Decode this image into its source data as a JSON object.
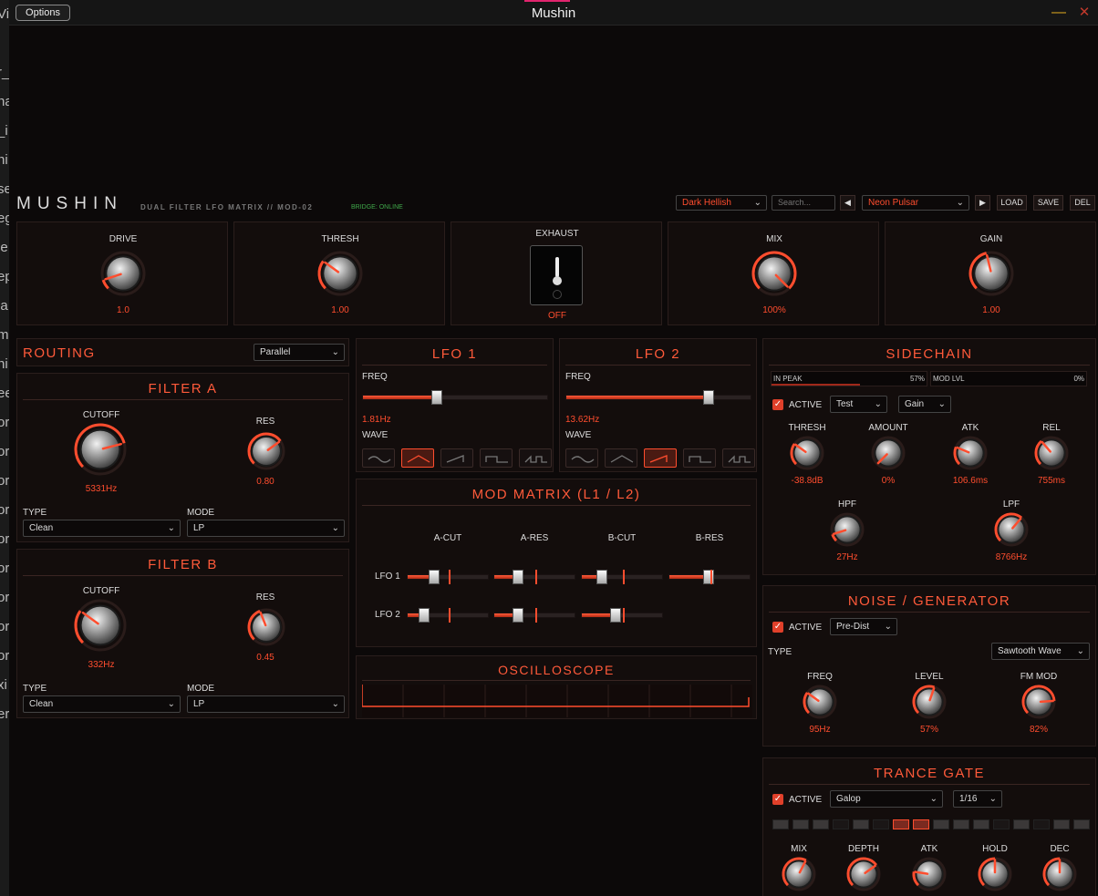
{
  "window": {
    "title": "Mushin",
    "options_label": "Options",
    "minimize_glyph": "—",
    "close_glyph": "✕"
  },
  "background_text": [
    "Vi",
    "",
    "r_",
    "na",
    "_i",
    "ni",
    "se",
    "eg",
    "le",
    "ep",
    "la",
    "m",
    "ni",
    "ee",
    "or",
    "or",
    "or",
    "or",
    "or",
    "or",
    "or",
    "or",
    "or",
    "xi",
    "er"
  ],
  "plugin": {
    "logo": "MUSHIN",
    "subtitle": "DUAL FILTER LFO MATRIX // MOD-02",
    "bridge_status": "BRIDGE: ONLINE",
    "theme_select": "Dark Hellish",
    "search_placeholder": "Search...",
    "preset": "Neon Pulsar",
    "prev_glyph": "◀",
    "next_glyph": "▶",
    "load": "LOAD",
    "save": "SAVE",
    "del": "DEL"
  },
  "top": {
    "drive": {
      "label": "DRIVE",
      "value": "1.0",
      "level": 0.1
    },
    "thresh": {
      "label": "THRESH",
      "value": "1.00",
      "level": 0.3
    },
    "exhaust": {
      "label": "EXHAUST",
      "value": "OFF"
    },
    "mix": {
      "label": "MIX",
      "value": "100%",
      "level": 1.0
    },
    "gain": {
      "label": "GAIN",
      "value": "1.00",
      "level": 0.45
    }
  },
  "routing": {
    "title": "ROUTING",
    "mode": "Parallel"
  },
  "filter_a": {
    "title": "FILTER A",
    "cutoff_label": "CUTOFF",
    "cutoff_value": "5331Hz",
    "cutoff_level": 0.78,
    "res_label": "RES",
    "res_value": "0.80",
    "res_level": 0.7,
    "type_label": "TYPE",
    "type": "Clean",
    "mode_label": "MODE",
    "mode": "LP"
  },
  "filter_b": {
    "title": "FILTER B",
    "cutoff_label": "CUTOFF",
    "cutoff_value": "332Hz",
    "cutoff_level": 0.3,
    "res_label": "RES",
    "res_value": "0.45",
    "res_level": 0.42,
    "type_label": "TYPE",
    "type": "Clean",
    "mode_label": "MODE",
    "mode": "LP"
  },
  "lfo1": {
    "title": "LFO 1",
    "freq_label": "FREQ",
    "freq_value": "1.81Hz",
    "freq_level": 0.39,
    "wave_label": "WAVE",
    "active_wave": 1
  },
  "lfo2": {
    "title": "LFO 2",
    "freq_label": "FREQ",
    "freq_value": "13.62Hz",
    "freq_level": 0.78,
    "wave_label": "WAVE",
    "active_wave": 2
  },
  "matrix": {
    "title": "MOD MATRIX (L1 / L2)",
    "columns": [
      "A-CUT",
      "A-RES",
      "B-CUT",
      "B-RES"
    ],
    "rows": [
      "LFO 1",
      "LFO 2"
    ],
    "amounts": [
      [
        0.3,
        0.25,
        0.2,
        0.47
      ],
      [
        0.15,
        0.25,
        0.4,
        null
      ]
    ]
  },
  "scope": {
    "title": "OSCILLOSCOPE"
  },
  "sidechain": {
    "title": "SIDECHAIN",
    "in_peak_label": "IN PEAK",
    "in_peak_value": "57%",
    "in_peak_level": 0.57,
    "mod_lvl_label": "MOD LVL",
    "mod_lvl_value": "0%",
    "mod_lvl_level": 0,
    "active_label": "ACTIVE",
    "source": "Test",
    "target": "Gain",
    "knobs": [
      {
        "label": "THRESH",
        "value": "-38.8dB",
        "level": 0.3
      },
      {
        "label": "AMOUNT",
        "value": "0%",
        "level": 0.0
      },
      {
        "label": "ATK",
        "value": "106.6ms",
        "level": 0.25
      },
      {
        "label": "REL",
        "value": "755ms",
        "level": 0.35
      },
      {
        "label": "HPF",
        "value": "27Hz",
        "level": 0.1
      },
      {
        "label": "LPF",
        "value": "8766Hz",
        "level": 0.65
      }
    ]
  },
  "noise": {
    "title": "NOISE / GENERATOR",
    "active_label": "ACTIVE",
    "position": "Pre-Dist",
    "type_label": "TYPE",
    "type": "Sawtooth Wave",
    "knobs": [
      {
        "label": "FREQ",
        "value": "95Hz",
        "level": 0.3
      },
      {
        "label": "LEVEL",
        "value": "57%",
        "level": 0.57
      },
      {
        "label": "FM MOD",
        "value": "82%",
        "level": 0.82
      }
    ]
  },
  "gate": {
    "title": "TRANCE GATE",
    "active_label": "ACTIVE",
    "pattern": "Galop",
    "rate": "1/16",
    "steps": [
      "on",
      "on",
      "on",
      "dark",
      "on",
      "dark",
      "active",
      "active",
      "on",
      "on",
      "on",
      "dark",
      "on",
      "dark",
      "on",
      "on"
    ],
    "knobs": [
      {
        "label": "MIX",
        "value": "",
        "level": 0.6
      },
      {
        "label": "DEPTH",
        "value": "",
        "level": 0.7
      },
      {
        "label": "ATK",
        "value": "",
        "level": 0.2
      },
      {
        "label": "HOLD",
        "value": "",
        "level": 0.5
      },
      {
        "label": "DEC",
        "value": "",
        "level": 0.5
      }
    ]
  },
  "colors": {
    "accent": "#ff4d2e",
    "panel": "#130d0c",
    "bg": "#0c0909"
  }
}
